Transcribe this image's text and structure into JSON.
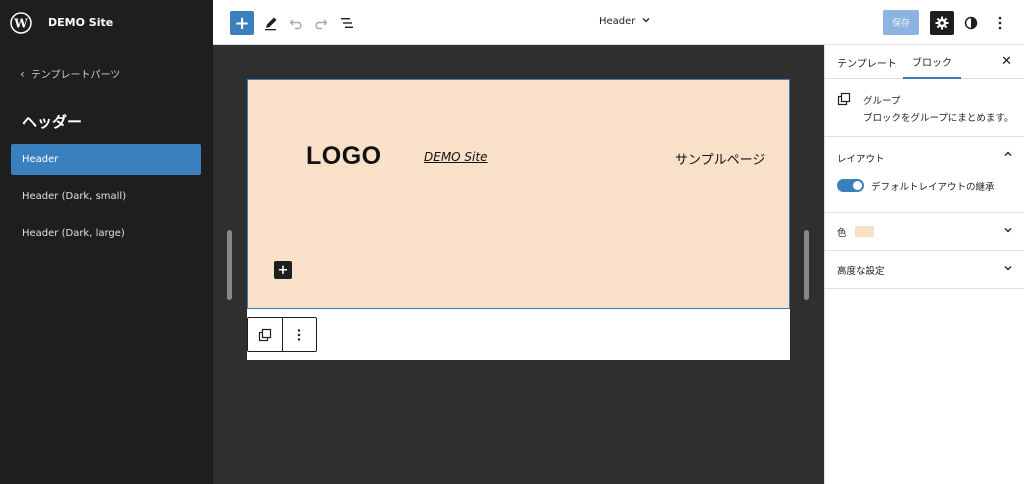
{
  "site": {
    "title": "DEMO Site"
  },
  "sidebar": {
    "back_label": "テンプレートパーツ",
    "section_title": "ヘッダー",
    "items": [
      {
        "label": "Header",
        "active": true
      },
      {
        "label": "Header (Dark, small)"
      },
      {
        "label": "Header (Dark, large)"
      }
    ]
  },
  "toolbar": {
    "document_title": "Header",
    "save_label": "保存"
  },
  "canvas": {
    "logo_text": "LOGO",
    "site_name": "DEMO Site",
    "nav_link": "サンプルページ"
  },
  "panel": {
    "tabs": [
      "テンプレート",
      "ブロック"
    ],
    "block_title": "グループ",
    "block_description": "ブロックをグループにまとめます。",
    "layout_title": "レイアウト",
    "toggle_label": "デフォルトレイアウトの継承",
    "toggle_on": true,
    "color_title": "色",
    "advanced_title": "高度な設定"
  },
  "colors": {
    "accent": "#3a80bf",
    "group_background": "#f9e0c9",
    "sidebar_bg": "#1e1e1e"
  },
  "icons": {
    "wp_logo": "wordpress-icon",
    "pencil": "pencil-icon",
    "undo": "undo-icon",
    "redo": "redo-icon",
    "list_view": "list-view-icon",
    "settings": "gear-icon",
    "styles": "half-circle-icon",
    "more": "more-vertical-icon",
    "group": "group-icon"
  }
}
